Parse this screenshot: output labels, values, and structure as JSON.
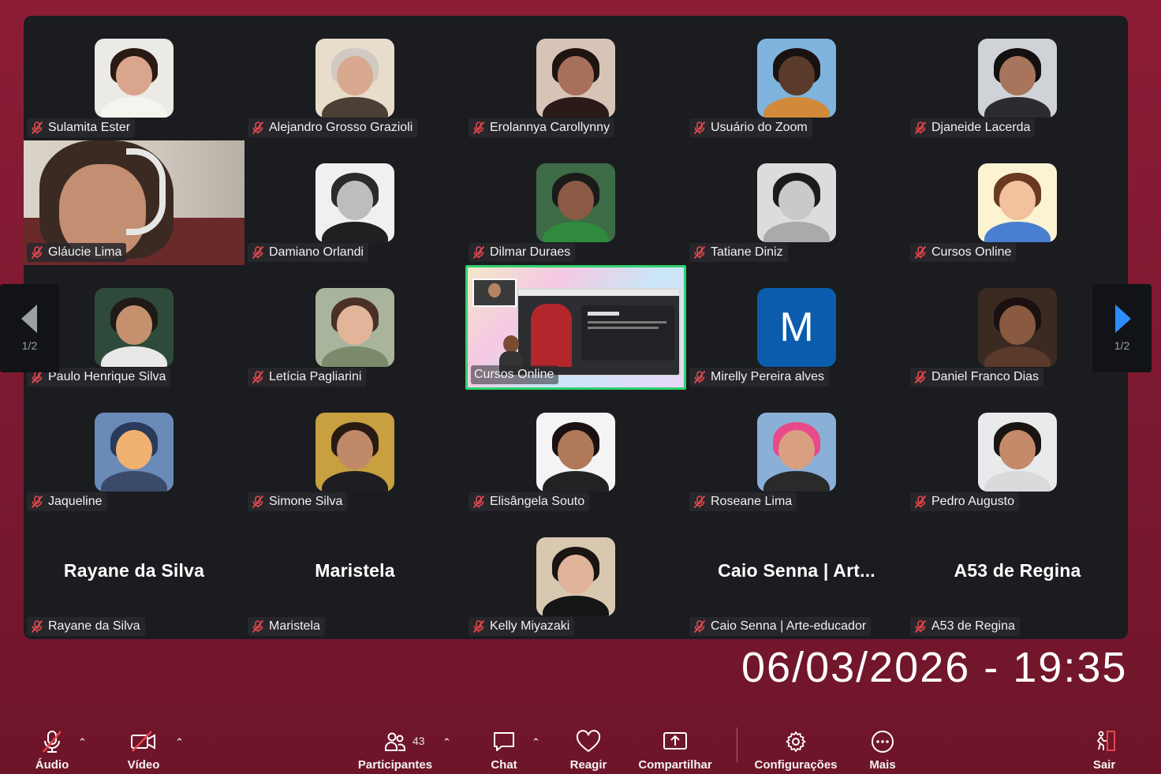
{
  "participants": [
    {
      "name": "Sulamita Ester",
      "muted": true,
      "avatar": {
        "bg": "#eceae6",
        "skin": "#d9a58c",
        "hair": "#2a1a14",
        "body": "#f6f4ef"
      }
    },
    {
      "name": "Alejandro Grosso Grazioli",
      "muted": true,
      "avatar": {
        "bg": "#e8dccb",
        "skin": "#d8a98e",
        "hair": "#cfcac2",
        "body": "#4a4036"
      }
    },
    {
      "name": "Erolannya Carollynny",
      "muted": true,
      "avatar": {
        "bg": "#d7c4b6",
        "skin": "#a8705a",
        "hair": "#1e1410",
        "body": "#2a1a18"
      }
    },
    {
      "name": "Usuário do Zoom",
      "muted": true,
      "avatar": {
        "bg": "#7fb4de",
        "skin": "#5a3a2a",
        "hair": "#1a1210",
        "body": "#d08a3a"
      }
    },
    {
      "name": "Djaneide Lacerda",
      "muted": true,
      "avatar": {
        "bg": "#cfd3d8",
        "skin": "#a8745c",
        "hair": "#141010",
        "body": "#2c2c30"
      }
    },
    {
      "name": "Gláucie Lima",
      "muted": true,
      "video": true
    },
    {
      "name": "Damiano Orlandi",
      "muted": true,
      "avatar": {
        "bg": "#f0f0f0",
        "skin": "#bdbdbd",
        "hair": "#2b2b2b",
        "body": "#202020"
      }
    },
    {
      "name": "Dilmar Duraes",
      "muted": true,
      "avatar": {
        "bg": "#3d6b46",
        "skin": "#8a5a44",
        "hair": "#1a1a1a",
        "body": "#2f8a3e"
      }
    },
    {
      "name": "Tatiane Diniz",
      "muted": true,
      "avatar": {
        "bg": "#dcdcdc",
        "skin": "#c9c9c9",
        "hair": "#1c1c1c",
        "body": "#aaaaaa"
      }
    },
    {
      "name": "Cursos Online",
      "muted": true,
      "avatar": {
        "bg": "#fbf3d2",
        "skin": "#f2c19e",
        "hair": "#6a3a20",
        "body": "#4a7ed0"
      }
    },
    {
      "name": "Paulo Henrique Silva",
      "muted": true,
      "avatar": {
        "bg": "#2e4a3a",
        "skin": "#c4906e",
        "hair": "#201a16",
        "body": "#e8e8e8"
      }
    },
    {
      "name": "Letícia Pagliarini",
      "muted": true,
      "avatar": {
        "bg": "#a8b49c",
        "skin": "#e2b49a",
        "hair": "#4a3026",
        "body": "#7a8a6a"
      }
    },
    {
      "name": "Cursos Online",
      "muted": false,
      "screen_share": true
    },
    {
      "name": "Mirelly Pereira alves",
      "muted": true,
      "letter": "M",
      "letter_bg": "#0b5cad"
    },
    {
      "name": "Daniel Franco Dias",
      "muted": true,
      "avatar": {
        "bg": "#3a2a22",
        "skin": "#8a5a40",
        "hair": "#1a1010",
        "body": "#5a3a2a"
      }
    },
    {
      "name": "Jaqueline",
      "muted": true,
      "avatar": {
        "bg": "#6a8ab8",
        "skin": "#f0b070",
        "hair": "#2a3a5a",
        "body": "#3a4a6a"
      }
    },
    {
      "name": "Simone Silva",
      "muted": true,
      "avatar": {
        "bg": "#c8a040",
        "skin": "#c08a6a",
        "hair": "#2a1a14",
        "body": "#1e1e22"
      }
    },
    {
      "name": "Elisângela Souto",
      "muted": true,
      "avatar": {
        "bg": "#f4f4f4",
        "skin": "#b07a5a",
        "hair": "#1a1212",
        "body": "#222222"
      }
    },
    {
      "name": "Roseane Lima",
      "muted": true,
      "avatar": {
        "bg": "#8ab0d8",
        "skin": "#d8a080",
        "hair": "#e84a8a",
        "body": "#2a2a2a"
      }
    },
    {
      "name": "Pedro Augusto",
      "muted": true,
      "avatar": {
        "bg": "#e8eaec",
        "skin": "#c48a6a",
        "hair": "#1a1412",
        "body": "#d8dadc"
      }
    },
    {
      "name": "Rayane da Silva",
      "muted": true,
      "display_name": "Rayane da Silva"
    },
    {
      "name": "Maristela",
      "muted": true,
      "display_name": "Maristela"
    },
    {
      "name": "Kelly Miyazaki",
      "muted": true,
      "avatar": {
        "bg": "#d8c8b0",
        "skin": "#e0b49a",
        "hair": "#1a1412",
        "body": "#151515"
      }
    },
    {
      "name": "Caio Senna | Arte-educador",
      "muted": true,
      "display_name": "Caio Senna | Art..."
    },
    {
      "name": "A53 de Regina",
      "muted": true,
      "display_name": "A53 de Regina"
    }
  ],
  "pagination": {
    "prev_page": "1/2",
    "next_page": "1/2"
  },
  "timestamp": "06/03/2026 - 19:35",
  "toolbar": {
    "audio": "Áudio",
    "video": "Vídeo",
    "participants": "Participantes",
    "participants_count": "43",
    "chat": "Chat",
    "react": "Reagir",
    "share": "Compartilhar",
    "settings": "Configurações",
    "more": "Mais",
    "leave": "Sair"
  },
  "colors": {
    "background": "#8c1c36",
    "panel": "#1a1c20",
    "mute_red": "#e5484d",
    "active_green": "#2fd36b",
    "nav_blue": "#2d8cff"
  }
}
